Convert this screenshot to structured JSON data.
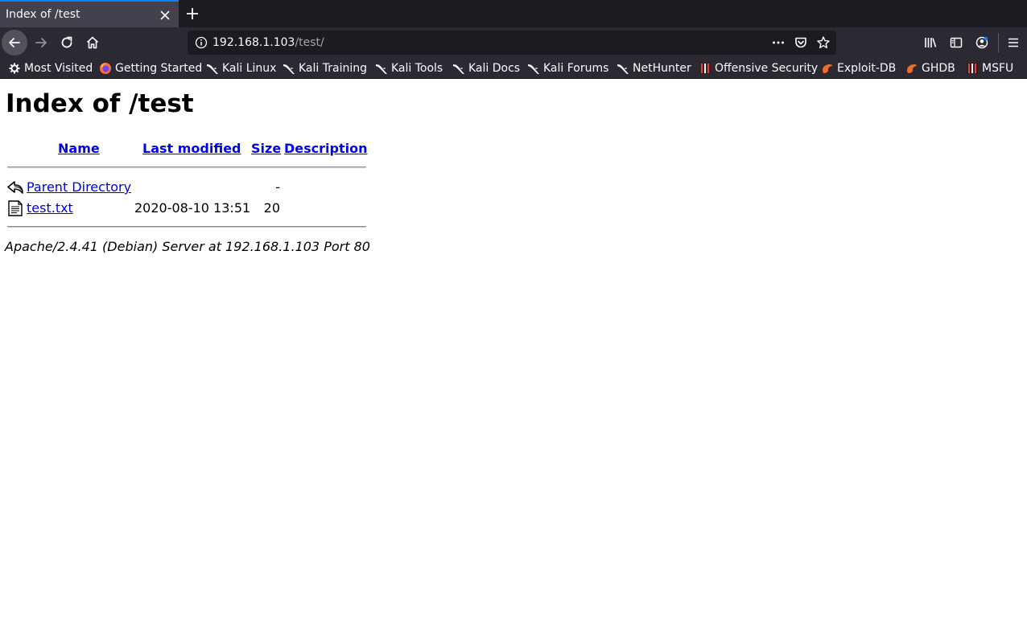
{
  "tab": {
    "title": "Index of /test"
  },
  "urlbar": {
    "host": "192.168.1.103",
    "path": "/test/"
  },
  "bookmarks": [
    {
      "label": "Most Visited",
      "icon": "gear-icon"
    },
    {
      "label": "Getting Started",
      "icon": "firefox-icon"
    },
    {
      "label": "Kali Linux",
      "icon": "kali-dragon-icon"
    },
    {
      "label": "Kali Training",
      "icon": "kali-dragon-icon"
    },
    {
      "label": "Kali Tools",
      "icon": "kali-dragon-icon"
    },
    {
      "label": "Kali Docs",
      "icon": "kali-dragon-icon"
    },
    {
      "label": "Kali Forums",
      "icon": "kali-dragon-icon"
    },
    {
      "label": "NetHunter",
      "icon": "kali-dragon-icon"
    },
    {
      "label": "Offensive Security",
      "icon": "offsec-icon"
    },
    {
      "label": "Exploit-DB",
      "icon": "exploitdb-icon"
    },
    {
      "label": "GHDB",
      "icon": "exploitdb-icon"
    },
    {
      "label": "MSFU",
      "icon": "offsec-icon"
    }
  ],
  "page": {
    "title": "Index of /test",
    "columns": {
      "name": "Name",
      "modified": "Last modified",
      "size": "Size",
      "description": "Description"
    },
    "rows": [
      {
        "name": "Parent Directory",
        "modified": "",
        "size": "-",
        "description": "",
        "icon": "back-arrow-icon"
      },
      {
        "name": "test.txt",
        "modified": "2020-08-10 13:51",
        "size": "20",
        "description": "",
        "icon": "text-file-icon"
      }
    ],
    "address": "Apache/2.4.41 (Debian) Server at 192.168.1.103 Port 80"
  },
  "colors": {
    "tab_accent": "#0a84ff",
    "chrome_dark": "#1c1b22",
    "chrome": "#2b2a33",
    "link": "#0000ee"
  }
}
